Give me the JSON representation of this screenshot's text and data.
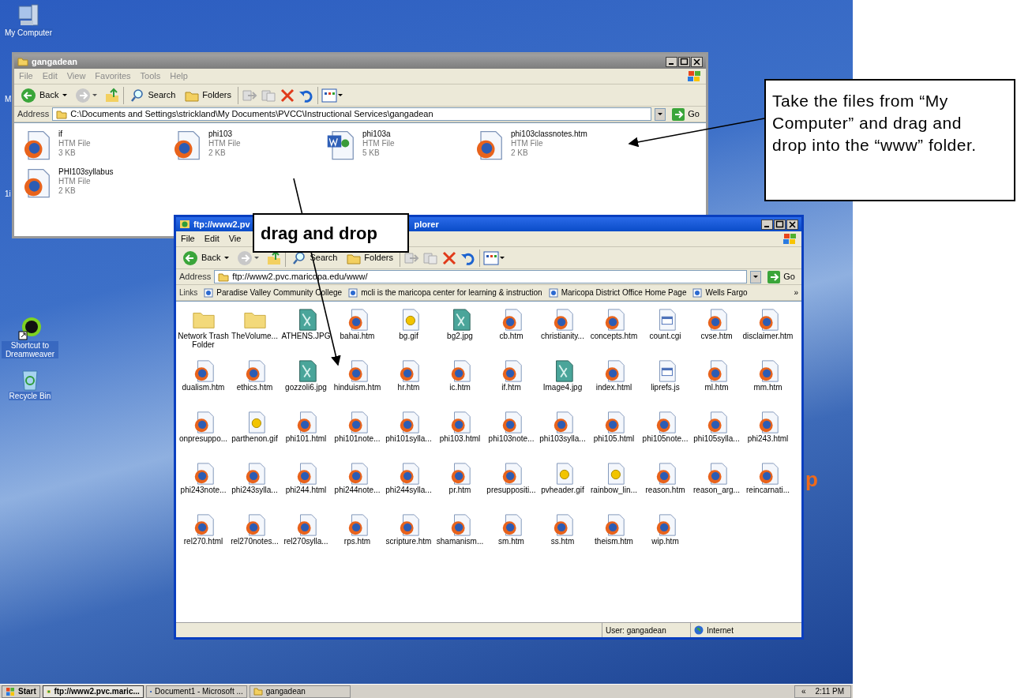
{
  "desktop_icons": [
    {
      "label": "My Computer",
      "kind": "computer"
    },
    {
      "label": "Shortcut to Dreamweaver",
      "kind": "shortcut"
    },
    {
      "label": "Recycle Bin",
      "kind": "recycle"
    }
  ],
  "desktop_fragments": [
    "M",
    "1i"
  ],
  "desktop_stray_text": "p",
  "folder_window": {
    "title": "gangadean",
    "active": false,
    "menu": [
      "File",
      "Edit",
      "View",
      "Favorites",
      "Tools",
      "Help"
    ],
    "toolbar": {
      "back": "Back",
      "search": "Search",
      "folders": "Folders"
    },
    "address": {
      "label": "Address",
      "value": "C:\\Documents and Settings\\strickland\\My Documents\\PVCC\\Instructional Services\\gangadean",
      "go": "Go"
    },
    "files": [
      {
        "name": "if",
        "type": "HTM File",
        "size": "3 KB",
        "kind": "html"
      },
      {
        "name": "phi103",
        "type": "HTM File",
        "size": "2 KB",
        "kind": "html"
      },
      {
        "name": "phi103a",
        "type": "HTM File",
        "size": "5 KB",
        "kind": "word"
      },
      {
        "name": "phi103classnotes.htm",
        "type": "HTM File",
        "size": "2 KB",
        "kind": "html"
      },
      {
        "name": "PHI103syllabus",
        "type": "HTM File",
        "size": "2 KB",
        "kind": "html"
      }
    ]
  },
  "ftp_window": {
    "title_parts": [
      "ftp://www2.pv",
      "plorer"
    ],
    "active": true,
    "menu": [
      "File",
      "Edit",
      "Vie"
    ],
    "toolbar": {
      "back": "Back",
      "search": "Search",
      "folders": "Folders"
    },
    "address": {
      "label": "Address",
      "value": "ftp://www2.pvc.maricopa.edu/www/",
      "go": "Go"
    },
    "links": {
      "label": "Links",
      "items": [
        "Paradise Valley Community College",
        "mcli is the maricopa center for learning & instruction",
        "Maricopa District Office Home Page",
        "Wells Fargo"
      ],
      "more": "»"
    },
    "files": [
      {
        "name": "Network Trash Folder",
        "kind": "folder"
      },
      {
        "name": "TheVolume...",
        "kind": "folder"
      },
      {
        "name": "ATHENS.JPG",
        "kind": "jpg"
      },
      {
        "name": "bahai.htm",
        "kind": "html"
      },
      {
        "name": "bg.gif",
        "kind": "gif"
      },
      {
        "name": "bg2.jpg",
        "kind": "jpg"
      },
      {
        "name": "cb.htm",
        "kind": "html"
      },
      {
        "name": "christianity...",
        "kind": "html"
      },
      {
        "name": "concepts.htm",
        "kind": "html"
      },
      {
        "name": "count.cgi",
        "kind": "script"
      },
      {
        "name": "cvse.htm",
        "kind": "html"
      },
      {
        "name": "disclaimer.htm",
        "kind": "html"
      },
      {
        "name": "dualism.htm",
        "kind": "html"
      },
      {
        "name": "ethics.htm",
        "kind": "html"
      },
      {
        "name": "gozzoli6.jpg",
        "kind": "jpg"
      },
      {
        "name": "hinduism.htm",
        "kind": "html"
      },
      {
        "name": "hr.htm",
        "kind": "html"
      },
      {
        "name": "ic.htm",
        "kind": "html"
      },
      {
        "name": "if.htm",
        "kind": "html"
      },
      {
        "name": "Image4.jpg",
        "kind": "jpg"
      },
      {
        "name": "index.html",
        "kind": "html"
      },
      {
        "name": "liprefs.js",
        "kind": "script"
      },
      {
        "name": "ml.htm",
        "kind": "html"
      },
      {
        "name": "mm.htm",
        "kind": "html"
      },
      {
        "name": "onpresuppo...",
        "kind": "html"
      },
      {
        "name": "parthenon.gif",
        "kind": "gif"
      },
      {
        "name": "phi101.html",
        "kind": "html"
      },
      {
        "name": "phi101note...",
        "kind": "html"
      },
      {
        "name": "phi101sylla...",
        "kind": "html"
      },
      {
        "name": "phi103.html",
        "kind": "html"
      },
      {
        "name": "phi103note...",
        "kind": "html"
      },
      {
        "name": "phi103sylla...",
        "kind": "html"
      },
      {
        "name": "phi105.html",
        "kind": "html"
      },
      {
        "name": "phi105note...",
        "kind": "html"
      },
      {
        "name": "phi105sylla...",
        "kind": "html"
      },
      {
        "name": "phi243.html",
        "kind": "html"
      },
      {
        "name": "phi243note...",
        "kind": "html"
      },
      {
        "name": "phi243sylla...",
        "kind": "html"
      },
      {
        "name": "phi244.html",
        "kind": "html"
      },
      {
        "name": "phi244note...",
        "kind": "html"
      },
      {
        "name": "phi244sylla...",
        "kind": "html"
      },
      {
        "name": "pr.htm",
        "kind": "html"
      },
      {
        "name": "presuppositi...",
        "kind": "html"
      },
      {
        "name": "pvheader.gif",
        "kind": "gif"
      },
      {
        "name": "rainbow_lin...",
        "kind": "gif"
      },
      {
        "name": "reason.htm",
        "kind": "html"
      },
      {
        "name": "reason_arg...",
        "kind": "html"
      },
      {
        "name": "reincarnati...",
        "kind": "html"
      },
      {
        "name": "rel270.html",
        "kind": "html"
      },
      {
        "name": "rel270notes...",
        "kind": "html"
      },
      {
        "name": "rel270sylla...",
        "kind": "html"
      },
      {
        "name": "rps.htm",
        "kind": "html"
      },
      {
        "name": "scripture.htm",
        "kind": "html"
      },
      {
        "name": "shamanism...",
        "kind": "html"
      },
      {
        "name": "sm.htm",
        "kind": "html"
      },
      {
        "name": "ss.htm",
        "kind": "html"
      },
      {
        "name": "theism.htm",
        "kind": "html"
      },
      {
        "name": "wip.htm",
        "kind": "html"
      }
    ],
    "status": {
      "user": "User: gangadean",
      "zone": "Internet"
    }
  },
  "taskbar": {
    "start": "Start",
    "items": [
      {
        "label": "ftp://www2.pvc.maric...",
        "kind": "ftp",
        "selected": true
      },
      {
        "label": "Document1 - Microsoft ...",
        "kind": "word",
        "selected": false
      },
      {
        "label": "gangadean",
        "kind": "folder",
        "selected": false
      }
    ],
    "tray_toggle": "«",
    "clock": "2:11 PM"
  },
  "callouts": [
    {
      "text": "drag and drop",
      "kind": "small"
    },
    {
      "text": "Take the files from “My Computer” and drag and drop into the “www” folder.",
      "kind": "large"
    }
  ]
}
